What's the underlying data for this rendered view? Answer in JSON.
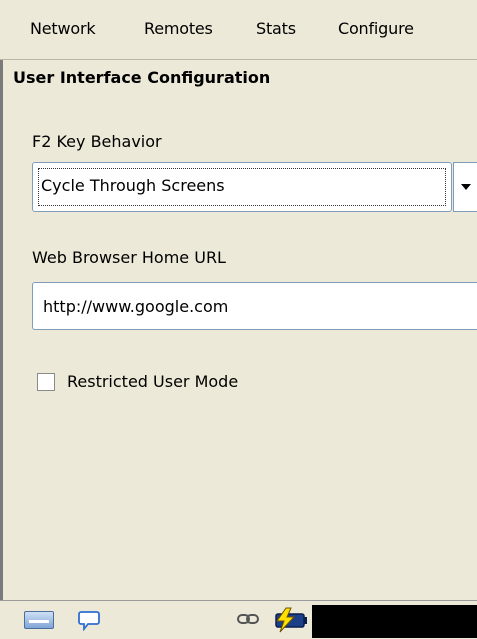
{
  "menu": {
    "items": [
      "Network",
      "Remotes",
      "Stats",
      "Configure"
    ]
  },
  "panel": {
    "title": "User Interface Configuration",
    "f2_label": "F2 Key Behavior",
    "f2_selected": "Cycle Through Screens",
    "url_label": "Web Browser Home URL",
    "url_value": "http://www.google.com",
    "restricted_label": "Restricted User Mode",
    "restricted_checked": false
  },
  "taskbar": {
    "icons": [
      "keyboard-icon",
      "chat-bubble-icon",
      "link-icon",
      "battery-charging-icon"
    ]
  }
}
